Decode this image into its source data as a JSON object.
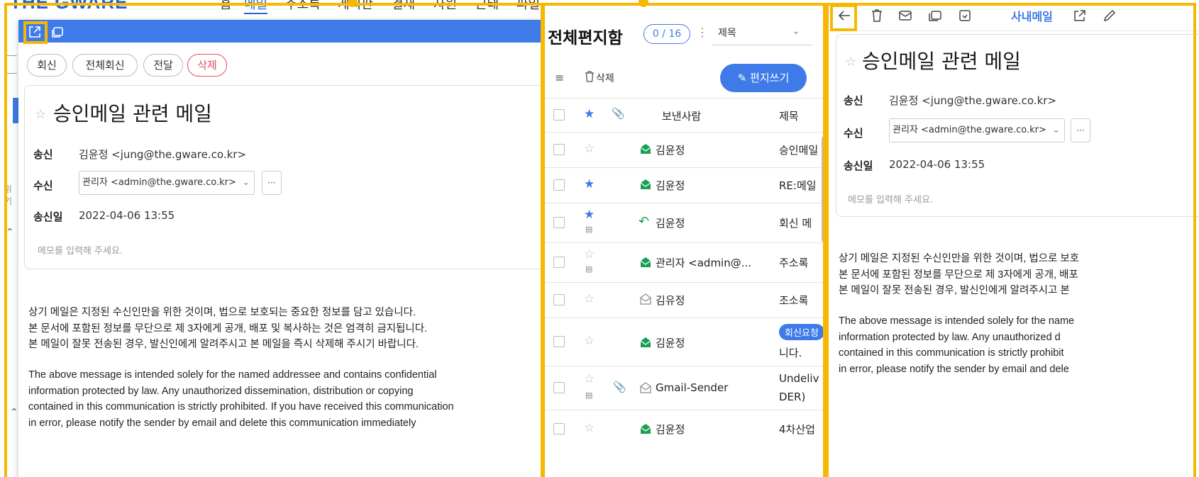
{
  "topnav": {
    "logo": "THE GWARE",
    "items": [
      "홈",
      "메일",
      "주소록",
      "게시판",
      "결재",
      "자원",
      "근태",
      "파일"
    ],
    "active_index": 1
  },
  "side_fragments": [
    "읽기"
  ],
  "popup": {
    "actions": {
      "reply": "회신",
      "reply_all": "전체회신",
      "forward": "전달",
      "delete": "삭제"
    },
    "mail": {
      "subject": "승인메일 관련 메일",
      "from_label": "송신",
      "from_value": "김윤정 <jung@the.gware.co.kr>",
      "to_label": "수신",
      "to_value": "관리자 <admin@the.gware.co.kr>",
      "more": "···",
      "date_label": "송신일",
      "date_value": "2022-04-06 13:55",
      "memo_placeholder": "메모를 입력해 주세요."
    },
    "body_ko": "상기 메일은 지정된 수신인만을 위한 것이며, 법으로 보호되는 중요한 정보를 담고 있습니다.\n본 문서에 포함된 정보를 무단으로 제 3자에게 공개, 배포 및 복사하는 것은 엄격히 금지됩니다.\n본 메일이 잘못 전송된 경우, 발신인에게 알려주시고 본 메일을 즉시 삭제해 주시기 바랍니다.",
    "body_en": "The above message is intended solely for the named addressee and contains confidential\ninformation protected by law. Any unauthorized dissemination, distribution or copying\ncontained in this communication is strictly prohibited. If you have received this communication\nin error, please notify the sender by email and delete this communication immediately"
  },
  "list": {
    "title": "전체편지함",
    "count": "0 / 16",
    "sort_select": "제목",
    "delete_label": "삭제",
    "compose_label": "편지쓰기",
    "col_sender": "보낸사람",
    "col_subject": "제목",
    "rows": [
      {
        "sender": "김윤정",
        "subject": "승인메일",
        "starred": false,
        "icon": "envelope-open-filled-icon",
        "memo": false,
        "attach": false
      },
      {
        "sender": "김윤정",
        "subject": "RE:메일",
        "starred": true,
        "icon": "envelope-open-filled-icon",
        "memo": false,
        "attach": false
      },
      {
        "sender": "김윤정",
        "subject": "회신 메",
        "starred": true,
        "icon": "reply-arrow-icon",
        "memo": true,
        "attach": false
      },
      {
        "sender": "관리자 <admin@...",
        "subject": "주소록 ",
        "starred": false,
        "icon": "envelope-open-filled-icon",
        "memo": true,
        "attach": false
      },
      {
        "sender": "김유정",
        "subject": "조소록 ",
        "starred": false,
        "icon": "envelope-open-outline-icon",
        "memo": false,
        "attach": false
      },
      {
        "sender": "김윤정",
        "subject": "니다.",
        "tag": "회신요청",
        "starred": false,
        "icon": "envelope-open-filled-icon",
        "memo": false,
        "attach": false
      },
      {
        "sender": "Gmail-Sender",
        "subject": "Undeliv",
        "subject2": "DER)",
        "starred": false,
        "icon": "envelope-open-outline-icon",
        "memo": true,
        "attach": true
      },
      {
        "sender": "김윤정",
        "subject": "4차산업",
        "starred": false,
        "icon": "envelope-open-filled-icon",
        "memo": false,
        "attach": false
      }
    ]
  },
  "reader": {
    "company_mail": "사내메일",
    "mail": {
      "subject": "승인메일 관련 메일",
      "from_label": "송신",
      "from_value": "김윤정 <jung@the.gware.co.kr>",
      "to_label": "수신",
      "to_value": "관리자 <admin@the.gware.co.kr>",
      "more": "···",
      "date_label": "송신일",
      "date_value": "2022-04-06 13:55",
      "memo_placeholder": "메모를 입력해 주세요."
    },
    "body_ko": "상기 메일은 지정된 수신인만을 위한 것이며, 법으로 보호\n본 문서에 포함된 정보를 무단으로 제 3자에게 공개, 배포\n본 메일이 잘못 전송된 경우, 발신인에게 알려주시고 본",
    "body_en": "The above message is intended solely for the name\ninformation protected by law. Any unauthorized d\ncontained in this communication is strictly prohibit\nin error, please notify the sender by email and dele"
  },
  "colors": {
    "accent": "#3e7be8",
    "highlight": "#f6b800",
    "danger": "#e0505c"
  }
}
